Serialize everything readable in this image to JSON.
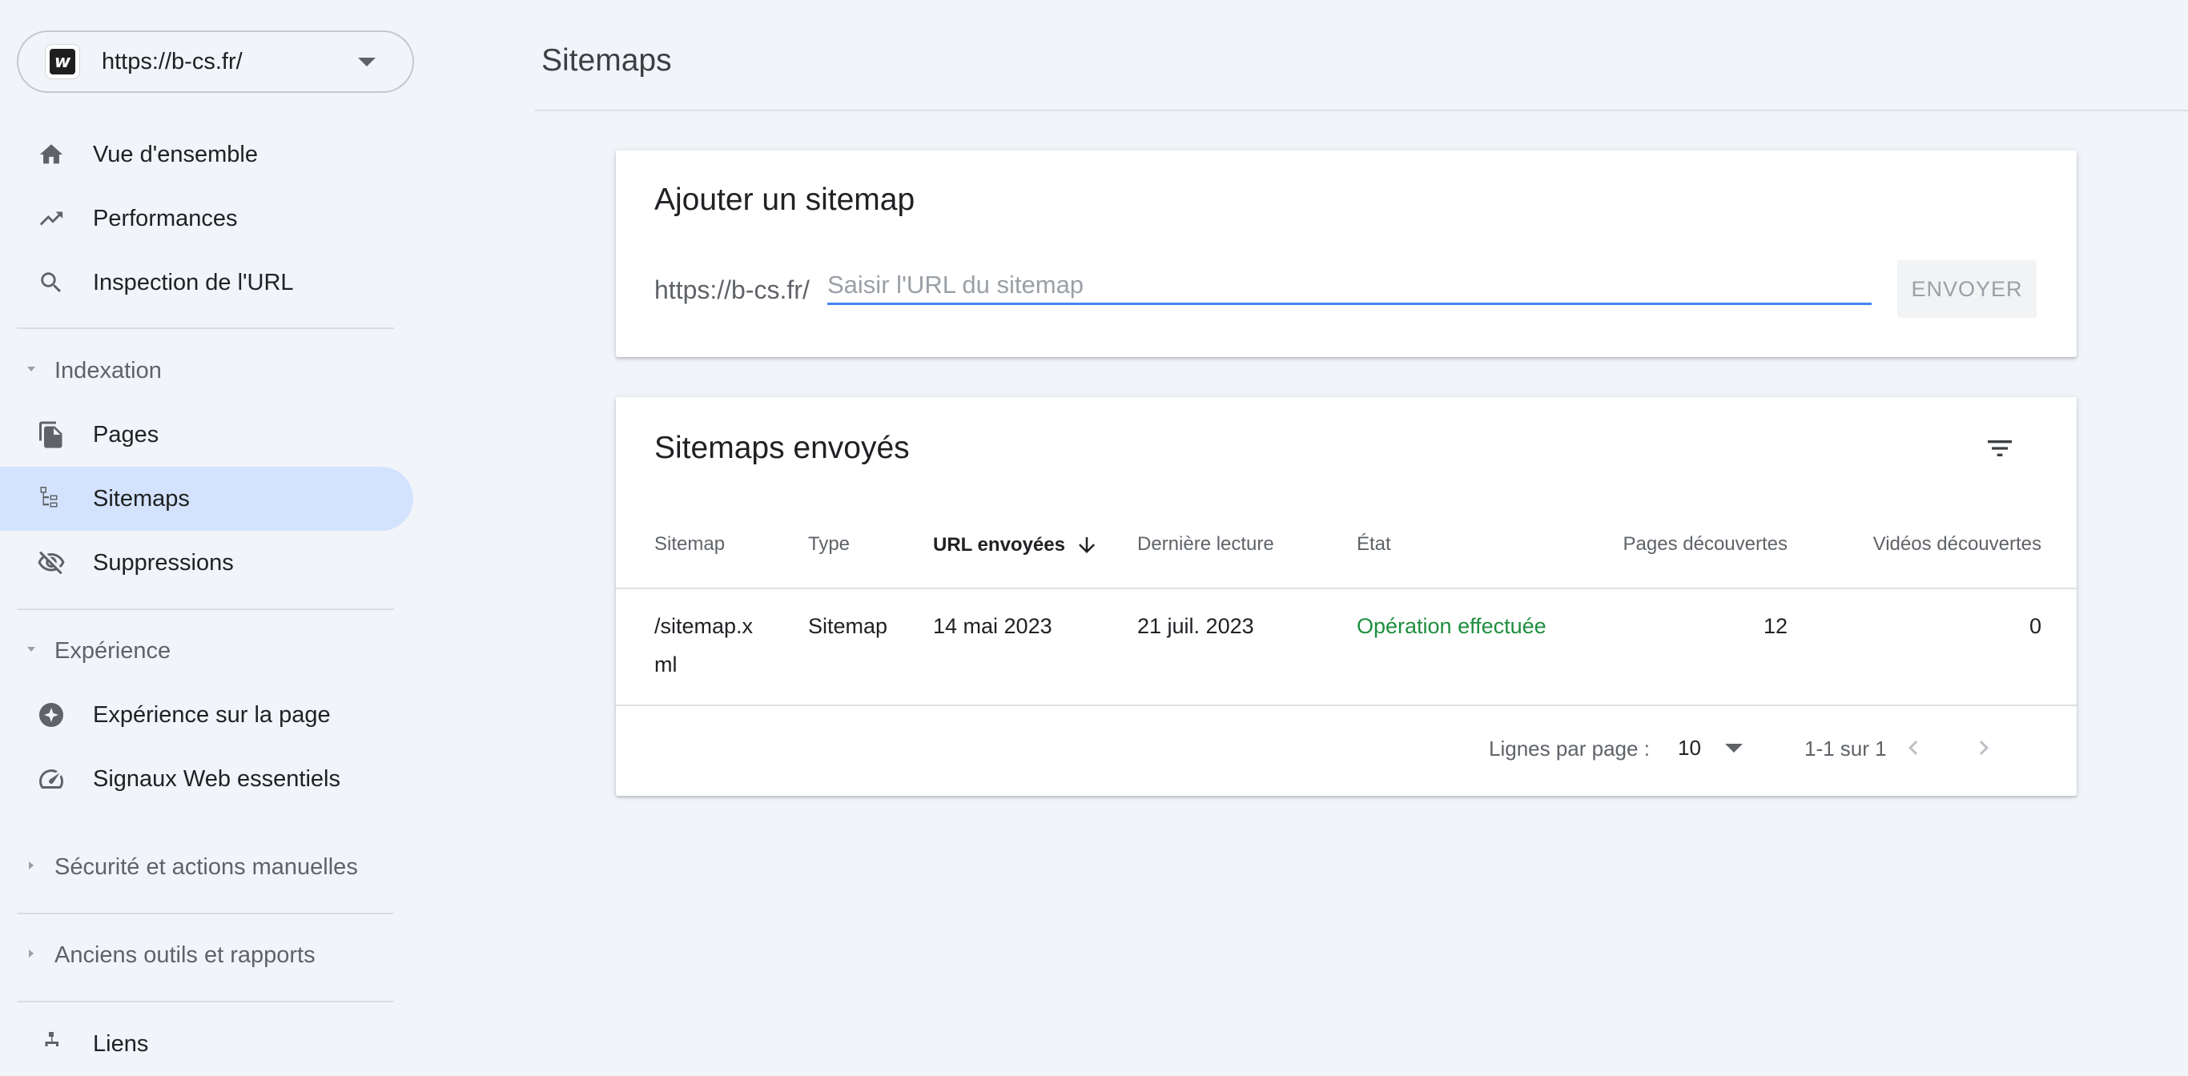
{
  "property": {
    "url": "https://b-cs.fr/",
    "favicon_letter": "w"
  },
  "nav": {
    "overview": "Vue d'ensemble",
    "performance": "Performances",
    "url_inspection": "Inspection de l'URL",
    "indexing_section": "Indexation",
    "pages": "Pages",
    "sitemaps": "Sitemaps",
    "removals": "Suppressions",
    "experience_section": "Expérience",
    "page_experience": "Expérience sur la page",
    "core_web_vitals": "Signaux Web essentiels",
    "security_section": "Sécurité et actions manuelles",
    "legacy_section": "Anciens outils et rapports",
    "links": "Liens"
  },
  "page": {
    "title": "Sitemaps"
  },
  "add_sitemap": {
    "title": "Ajouter un sitemap",
    "prefix": "https://b-cs.fr/",
    "placeholder": "Saisir l'URL du sitemap",
    "value": "",
    "submit_label": "ENVOYER"
  },
  "submitted": {
    "title": "Sitemaps envoyés",
    "columns": {
      "sitemap": "Sitemap",
      "type": "Type",
      "submitted": "URL envoyées",
      "last_read": "Dernière lecture",
      "status": "État",
      "pages": "Pages découvertes",
      "videos": "Vidéos découvertes"
    },
    "rows": [
      {
        "sitemap_line1": "/sitemap.x",
        "sitemap_line2": "ml",
        "type": "Sitemap",
        "submitted": "14 mai 2023",
        "last_read": "21 juil. 2023",
        "status": "Opération effectuée",
        "pages": "12",
        "videos": "0"
      }
    ],
    "footer": {
      "rows_per_page_label": "Lignes par page :",
      "rows_per_page_value": "10",
      "range": "1-1 sur 1"
    }
  },
  "colors": {
    "accent": "#4285f4",
    "active_nav": "#d3e3fd",
    "success": "#1e8e3e",
    "background": "#f1f4f9"
  }
}
